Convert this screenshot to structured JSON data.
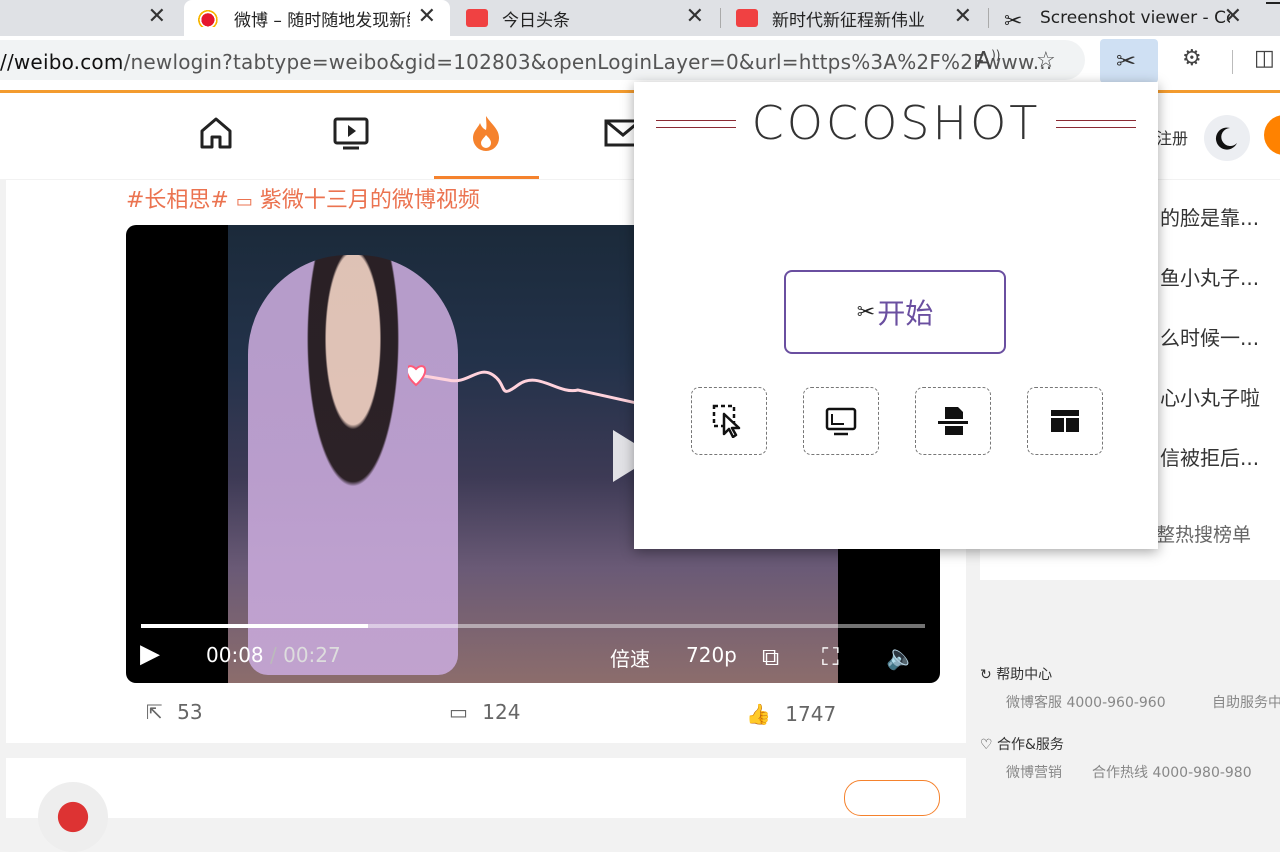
{
  "tabs": [
    {
      "title": "",
      "close": "✕"
    },
    {
      "title": "微博 – 随时随地发现新鲜事",
      "close": "✕"
    },
    {
      "title": "今日头条",
      "close": "✕"
    },
    {
      "title": "新时代新征程新伟业",
      "close": "✕"
    },
    {
      "title": "Screenshot viewer - Cocoshot",
      "close": "✕"
    }
  ],
  "address": {
    "url_prefix": "//weibo.com",
    "url_rest": "/newlogin?tabtype=weibo&gid=102803&openLoginLayer=0&url=https%3A%2F%2Fwww..."
  },
  "weibo_nav": {
    "register": "注册"
  },
  "post": {
    "hashtag": "#长相思#",
    "video_source": "紫微十三月的微博视频",
    "progress": 0.29,
    "time_current": "00:08",
    "time_sep": "/",
    "time_total": "00:27",
    "speed_label": "倍速",
    "quality_label": "720p",
    "repost_count": "53",
    "comment_count": "124",
    "like_count": "1747"
  },
  "hot_list": {
    "items": [
      "的脸是靠...",
      "鱼小丸子...",
      "么时候一...",
      "心小丸子啦",
      "信被拒后..."
    ],
    "more_label": "整热搜榜单"
  },
  "footer": {
    "help_title": "帮助中心",
    "help_items": [
      "微博客服 4000-960-960",
      "自助服务中心"
    ],
    "coop_title": "合作&服务",
    "coop_items": [
      "微博营销",
      "合作热线 4000-980-980"
    ]
  },
  "popup": {
    "brand": "COCOSHOT",
    "start_label": "开始",
    "tools": [
      "select-area",
      "visible-screen",
      "full-page",
      "layout"
    ]
  },
  "colors": {
    "weibo_orange": "#f5822d",
    "popup_accent": "#6a4fa0",
    "brand_line": "#8a2a34"
  }
}
